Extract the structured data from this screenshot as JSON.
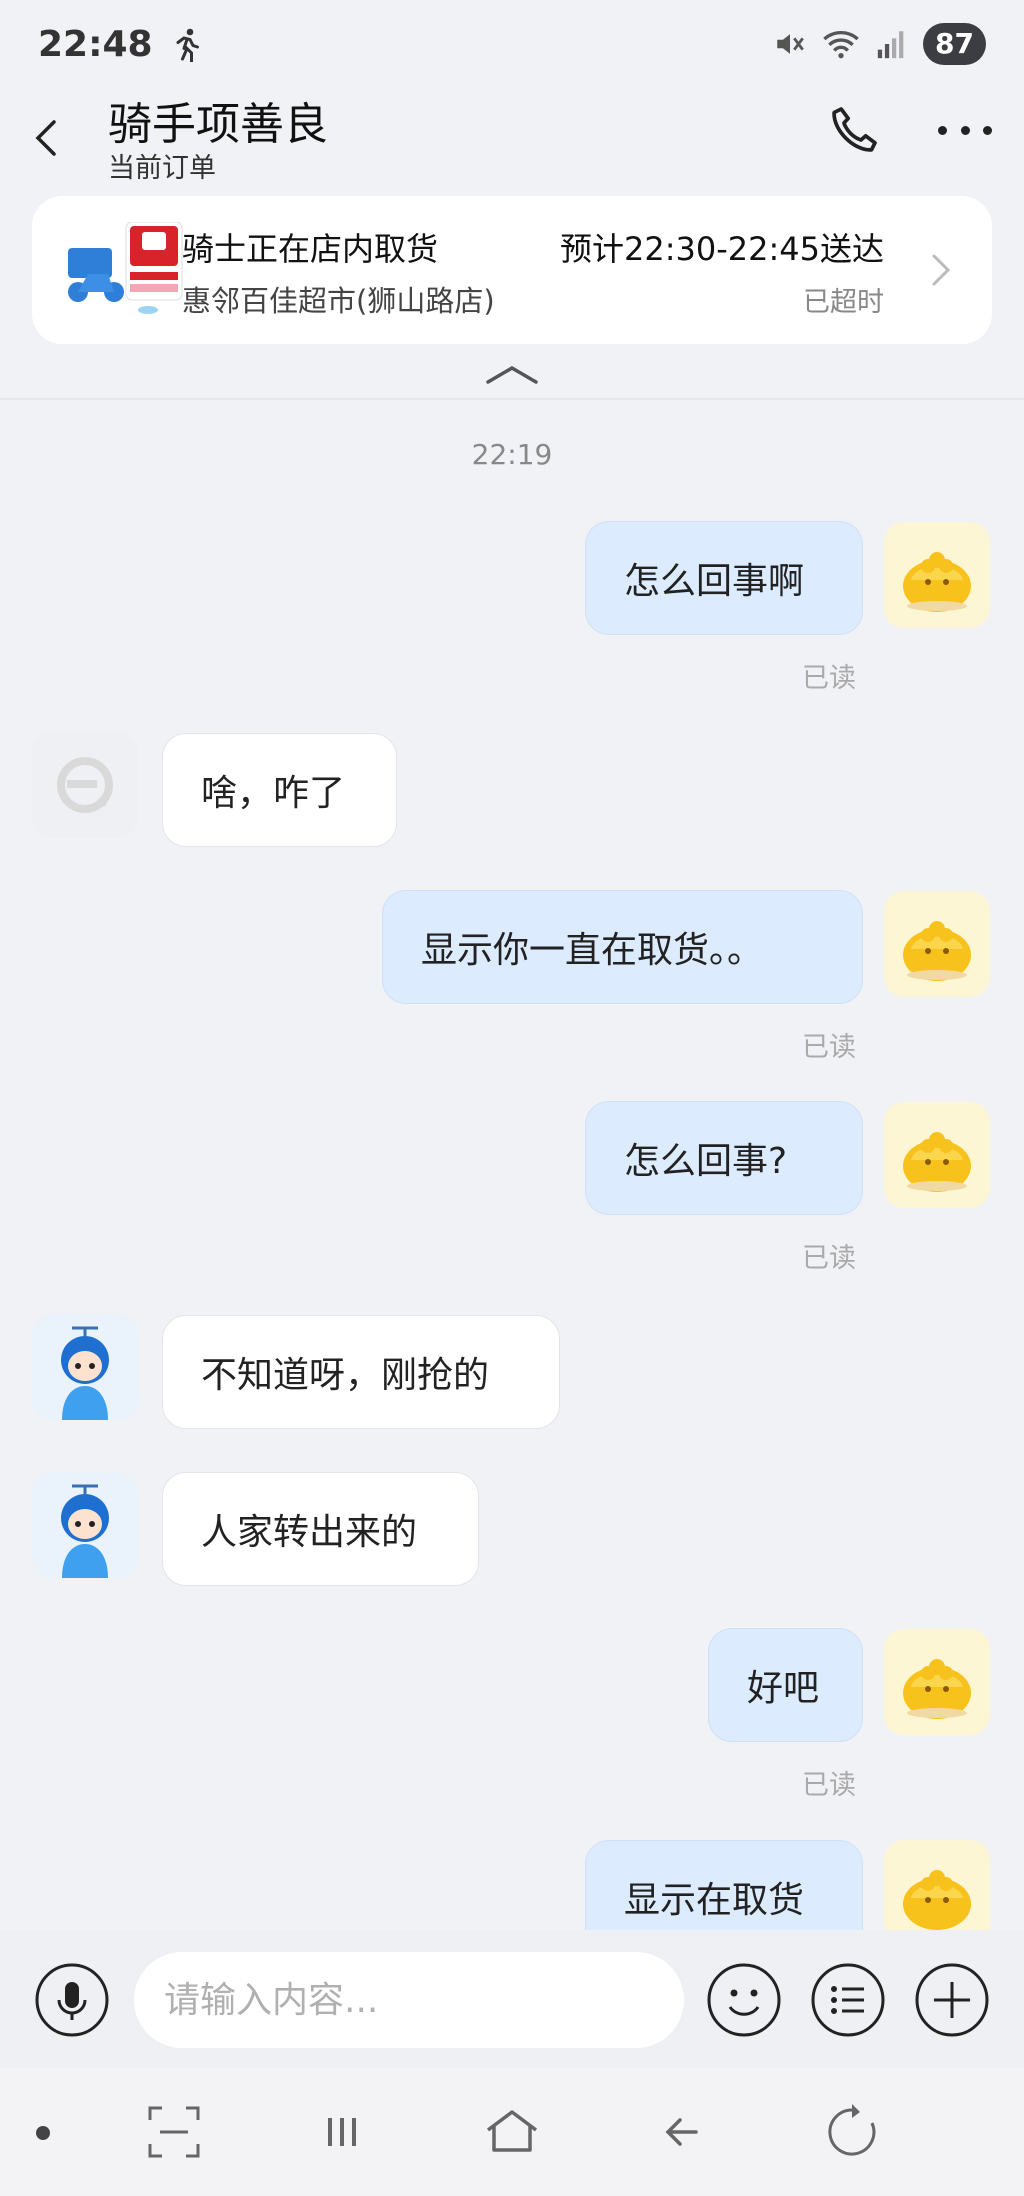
{
  "status_bar": {
    "time": "22:48",
    "battery": "87"
  },
  "header": {
    "title": "骑手项善良",
    "subtitle": "当前订单"
  },
  "order": {
    "status": "骑士正在店内取货",
    "eta": "预计22:30-22:45送达",
    "store": "惠邻百佳超市(狮山路店)",
    "overtime": "已超时"
  },
  "chat": {
    "timestamp": "22:19",
    "messages": [
      {
        "text": "怎么回事啊",
        "read": "已读"
      },
      {
        "text": "啥，咋了"
      },
      {
        "text": "显示你一直在取货。。",
        "read": "已读"
      },
      {
        "text": "怎么回事?",
        "read": "已读"
      },
      {
        "text": "不知道呀，刚抢的"
      },
      {
        "text": "人家转出来的"
      },
      {
        "text": "好吧",
        "read": "已读"
      },
      {
        "text": "显示在取货"
      }
    ]
  },
  "composer": {
    "placeholder": "请输入内容..."
  },
  "colors": {
    "bubble_out": "#dcebfd",
    "bubble_in": "#ffffff",
    "background": "#f1f2f6"
  }
}
